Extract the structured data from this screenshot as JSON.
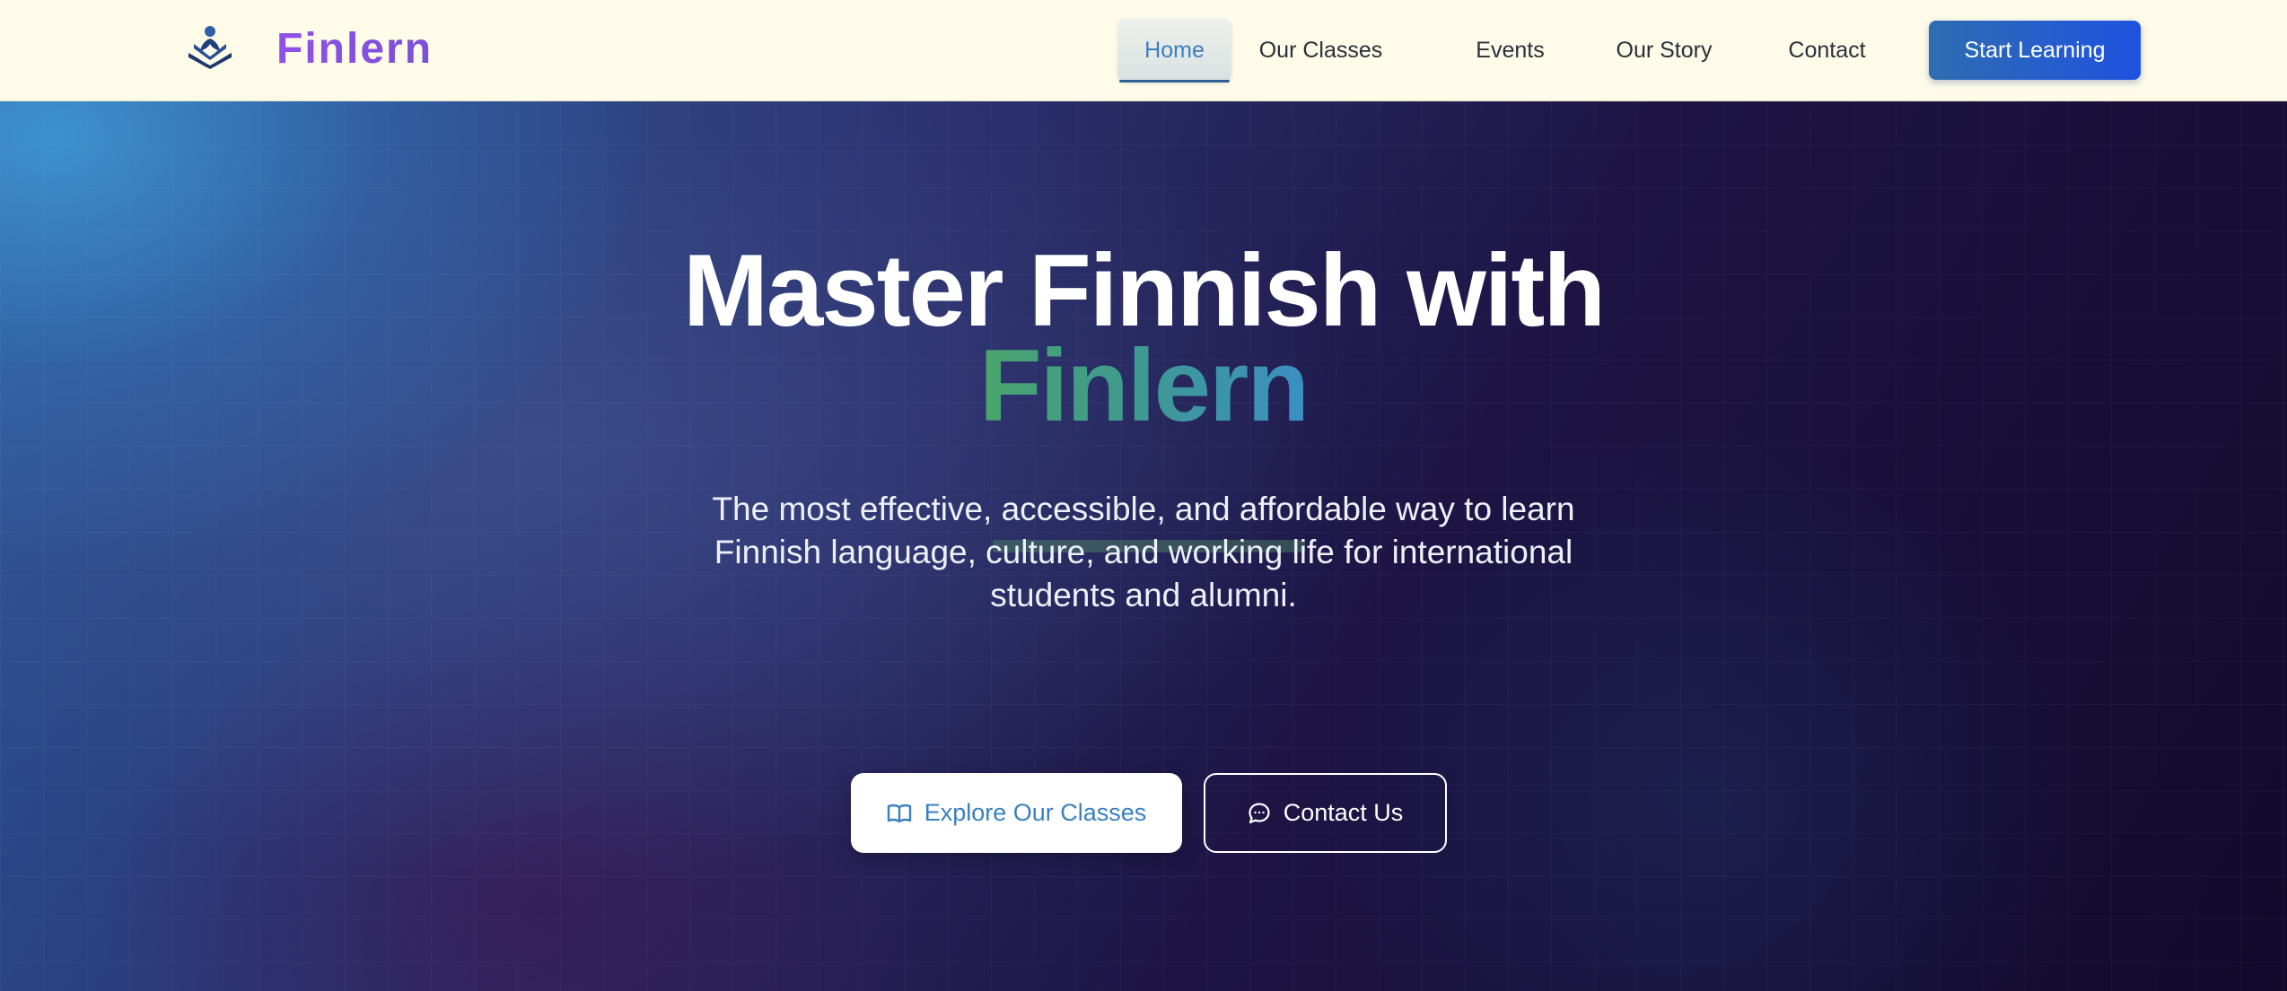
{
  "navbar": {
    "brand_name": "Finlern",
    "logo_icon": "reader-book-logo-icon",
    "links": [
      {
        "label": "Home",
        "active": true
      },
      {
        "label": "Our Classes",
        "active": false
      },
      {
        "label": "Events",
        "active": false
      },
      {
        "label": "Our Story",
        "active": false
      },
      {
        "label": "Contact",
        "active": false
      }
    ],
    "cta_label": "Start Learning"
  },
  "hero": {
    "title_line1": "Master Finnish with",
    "title_brand": "Finlern",
    "subtitle": "The most effective, accessible, and affordable way to learn Finnish language, culture, and working life for international students and alumni.",
    "primary_button": {
      "label": "Explore Our Classes",
      "icon": "book-open-icon"
    },
    "secondary_button": {
      "label": "Contact Us",
      "icon": "chat-bubble-icon"
    }
  },
  "colors": {
    "navbar_bg": "#fefbe8",
    "brand_purple": "#9050e8",
    "active_link": "#3a7fbf",
    "cta_gradient_start": "#2f6db1",
    "cta_gradient_end": "#1f52e0",
    "hero_brand_green": "#4aa56a",
    "hero_brand_blue": "#3a8fc4"
  }
}
